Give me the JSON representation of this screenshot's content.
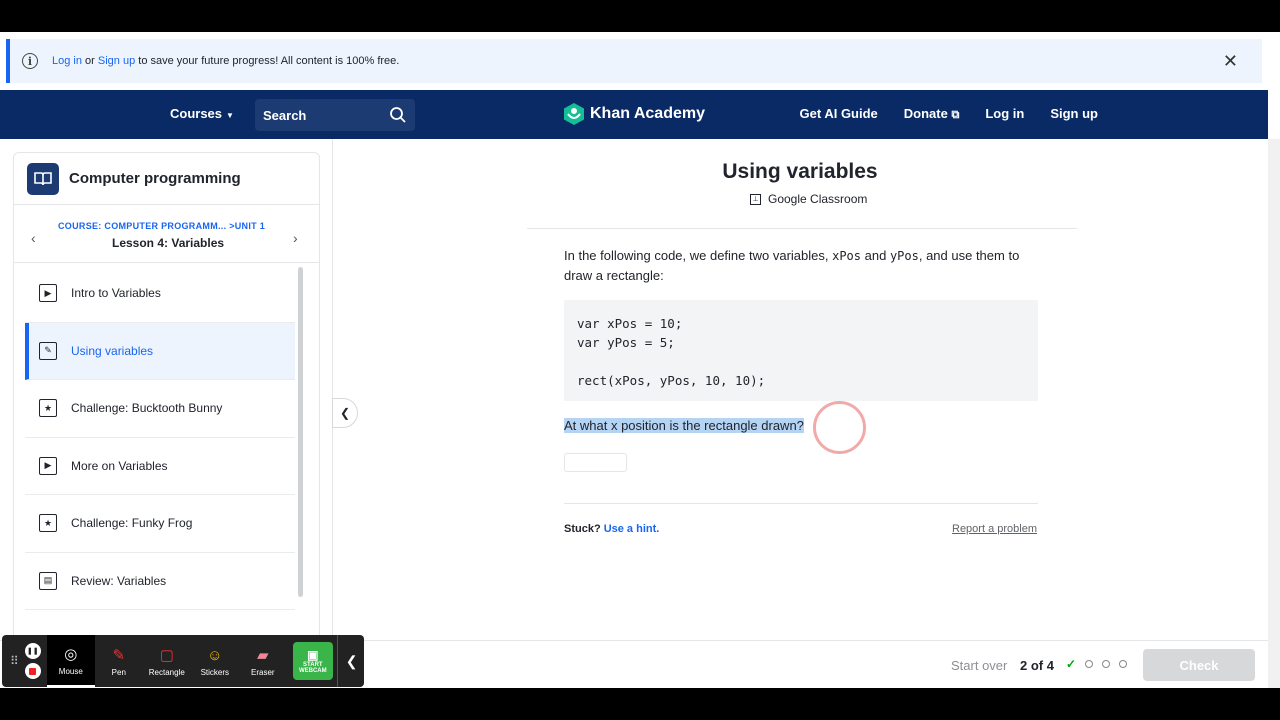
{
  "banner": {
    "login": "Log in",
    "or": " or ",
    "signup": "Sign up",
    "rest": " to save your future progress! All content is 100% free."
  },
  "nav": {
    "courses": "Courses",
    "search_placeholder": "Search",
    "brand": "Khan Academy",
    "links": [
      "Get AI Guide",
      "Donate",
      "Log in",
      "Sign up"
    ]
  },
  "sidebar": {
    "title": "Computer programming",
    "course_crumb": "COURSE: COMPUTER PROGRAMM... >UNIT 1",
    "lesson": "Lesson 4: Variables",
    "items": [
      {
        "label": "Intro to Variables",
        "icon": "play-icon"
      },
      {
        "label": "Using variables",
        "icon": "pencil-icon"
      },
      {
        "label": "Challenge: Bucktooth Bunny",
        "icon": "star-icon"
      },
      {
        "label": "More on Variables",
        "icon": "play-icon"
      },
      {
        "label": "Challenge: Funky Frog",
        "icon": "star-icon"
      },
      {
        "label": "Review: Variables",
        "icon": "document-icon"
      }
    ]
  },
  "exercise": {
    "title": "Using variables",
    "google_classroom": "Google Classroom",
    "intro_a": "In the following code, we define two variables, ",
    "var1": "xPos",
    "intro_b": " and ",
    "var2": "yPos",
    "intro_c": ", and use them to draw a rectangle:",
    "code": "var xPos = 10;\nvar yPos = 5;\n\nrect(xPos, yPos, 10, 10);",
    "question": "At what x position is the rectangle drawn?",
    "stuck": "Stuck?",
    "hint": "Use a hint.",
    "report": "Report a problem"
  },
  "footer": {
    "start_over": "Start over",
    "progress": "2 of 4",
    "check": "Check"
  },
  "recorder": {
    "tools": [
      "Mouse",
      "Pen",
      "Rectangle",
      "Stickers",
      "Eraser"
    ],
    "webcam": "START WEBCAM"
  }
}
